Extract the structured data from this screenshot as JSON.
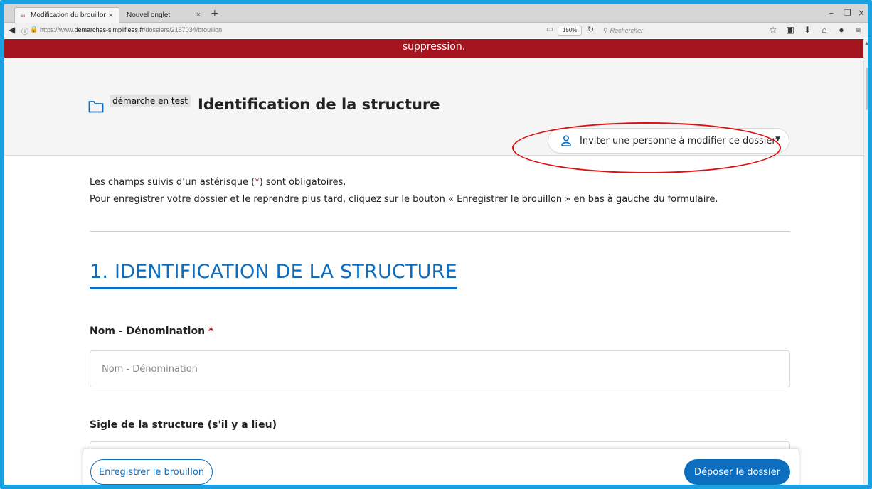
{
  "browser": {
    "tabs": [
      {
        "label": "Modification du brouillon ...",
        "close": "×"
      },
      {
        "label": "Nouvel onglet",
        "close": "×"
      }
    ],
    "new_tab": "+",
    "window_controls": {
      "minimize": "–",
      "restore": "❐",
      "close": "×"
    },
    "address": {
      "scheme": "https://www.",
      "host": "demarches-simplifiees.fr",
      "path": "/dossiers/2157034/brouillon",
      "zoom": "150%",
      "search_placeholder": "Rechercher"
    },
    "icons": [
      "star-icon",
      "reading-list-icon",
      "download-icon",
      "home-icon",
      "extension-icon",
      "menu-icon"
    ]
  },
  "page": {
    "banner_text": "suppression.",
    "badge": "démarche en test",
    "procedure_title": "Identification de la structure",
    "invite_button": "Inviter une personne à modifier ce dossier",
    "intro": {
      "line1_before": "Les champs suivis d’un astérisque (",
      "line1_star": "*",
      "line1_after": ") sont obligatoires.",
      "line2": "Pour enregistrer votre dossier et le reprendre plus tard, cliquez sur le bouton « Enregistrer le brouillon » en bas à gauche du formulaire."
    },
    "section_title": "1. IDENTIFICATION DE LA STRUCTURE",
    "fields": {
      "nom": {
        "label": "Nom - Dénomination",
        "required_mark": "*",
        "placeholder": "Nom - Dénomination"
      },
      "sigle": {
        "label": "Sigle de la structure (s'il y a lieu)"
      }
    },
    "footer": {
      "draft_button": "Enregistrer le brouillon",
      "submit_button": "Déposer le dossier"
    }
  },
  "colors": {
    "banner": "#a4151f",
    "primary": "#0d6ebf",
    "annotation": "#e01010",
    "frame": "#1ba1e2"
  }
}
